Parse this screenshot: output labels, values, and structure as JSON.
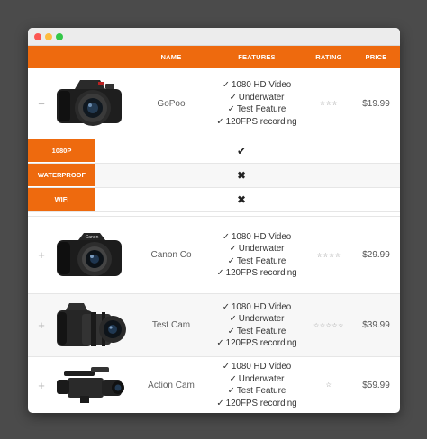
{
  "window": {
    "controls": [
      "close",
      "minimize",
      "maximize"
    ]
  },
  "colors": {
    "accent": "#ee6a0e",
    "background": "#4b4b4b"
  },
  "table": {
    "headers": {
      "image": "",
      "name": "NAME",
      "features": "FEATURES",
      "rating": "RATING",
      "price": "PRICE"
    },
    "check_glyph": "✓",
    "rows": [
      {
        "toggle": "−",
        "name": "GoPoo",
        "features": [
          "1080 HD Video",
          "Underwater",
          "Test Feature",
          "120FPS recording"
        ],
        "rating": "☆☆☆",
        "price": "$19.99",
        "image_icon": "dslr-camera-icon"
      },
      {
        "toggle": "+",
        "name": "Canon Co",
        "features": [
          "1080 HD Video",
          "Underwater",
          "Test Feature",
          "120FPS recording"
        ],
        "rating": "☆☆☆☆",
        "price": "$29.99",
        "image_icon": "bridge-camera-icon"
      },
      {
        "toggle": "+",
        "name": "Test Cam",
        "features": [
          "1080 HD Video",
          "Underwater",
          "Test Feature",
          "120FPS recording"
        ],
        "rating": "☆☆☆☆☆",
        "price": "$39.99",
        "image_icon": "superzoom-camera-icon"
      },
      {
        "toggle": "+",
        "name": "Action Cam",
        "features": [
          "1080 HD Video",
          "Underwater",
          "Test Feature",
          "120FPS recording"
        ],
        "rating": "☆",
        "price": "$59.99",
        "image_icon": "camcorder-icon"
      }
    ],
    "details": [
      {
        "label": "1080P",
        "value": "✔"
      },
      {
        "label": "WATERPROOF",
        "value": "✖"
      },
      {
        "label": "WIFI",
        "value": "✖"
      }
    ]
  }
}
